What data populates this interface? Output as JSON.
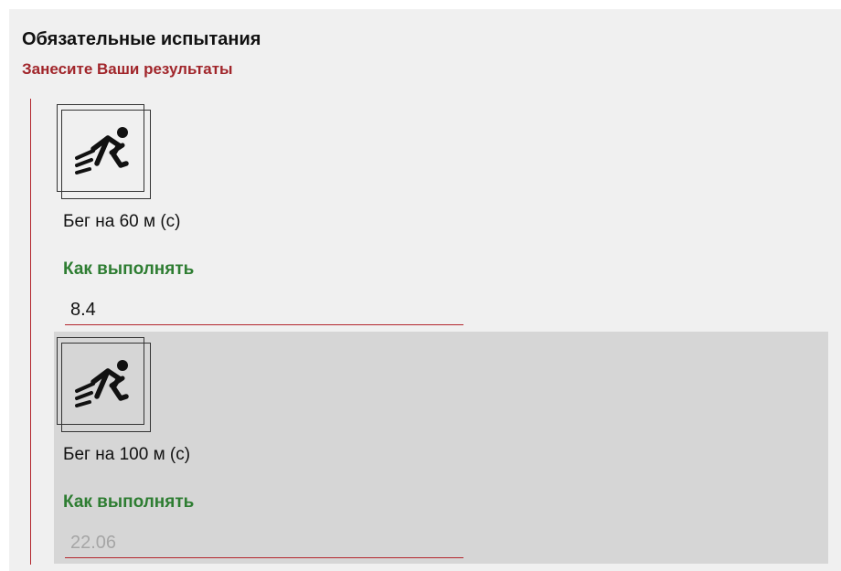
{
  "colors": {
    "panel_bg": "#f0f0f0",
    "subtitle": "#a1262b",
    "accent_line": "#b3262d",
    "link": "#2e7d32",
    "tile_active_bg": "#f0f0f0",
    "tile_hover_bg": "#d6d6d6"
  },
  "section": {
    "title": "Обязательные испытания",
    "subtitle": "Занесите Ваши результаты"
  },
  "tests": [
    {
      "icon": "running-icon",
      "name": "Бег на 60 м (с)",
      "how_to": "Как выполнять",
      "value": "8.4",
      "placeholder": "",
      "highlighted": false
    },
    {
      "icon": "running-icon",
      "name": "Бег на 100 м (с)",
      "how_to": "Как выполнять",
      "value": "",
      "placeholder": "22.06",
      "highlighted": true
    }
  ]
}
